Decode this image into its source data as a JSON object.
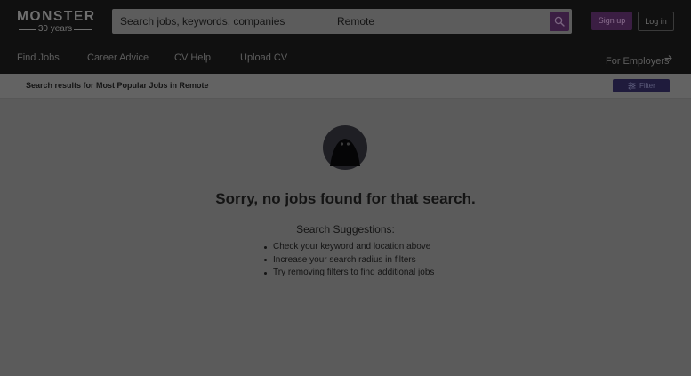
{
  "brand": {
    "name": "MONSTER",
    "tagline": "30 years"
  },
  "search": {
    "keywords_placeholder": "Search jobs, keywords, companies",
    "keywords_value": "",
    "location_value": "Remote",
    "button_icon": "search-icon"
  },
  "account": {
    "signup_label": "Sign up",
    "login_label": "Log in"
  },
  "nav": {
    "items": [
      {
        "label": "Find Jobs"
      },
      {
        "label": "Career Advice"
      },
      {
        "label": "CV Help"
      },
      {
        "label": "Upload CV"
      }
    ],
    "employers_label": "For Employers",
    "employers_icon": "arrow-right-icon"
  },
  "results": {
    "title": "Search results for Most Popular Jobs in Remote",
    "filter_label": "Filter",
    "filter_icon": "sliders-icon"
  },
  "empty_state": {
    "illustration": "monster-mascot-icon",
    "title": "Sorry, no jobs found for that search.",
    "suggestions_title": "Search Suggestions:",
    "suggestions": [
      "Check your keyword and location above",
      "Increase your search radius in filters",
      "Try removing filters to find additional jobs"
    ]
  },
  "colors": {
    "overlay_background": "#5b5b5b",
    "header_background": "#101010",
    "brand_purple": "#3b1e43",
    "filter_navy": "#1f1b3c",
    "text": "#141414"
  }
}
